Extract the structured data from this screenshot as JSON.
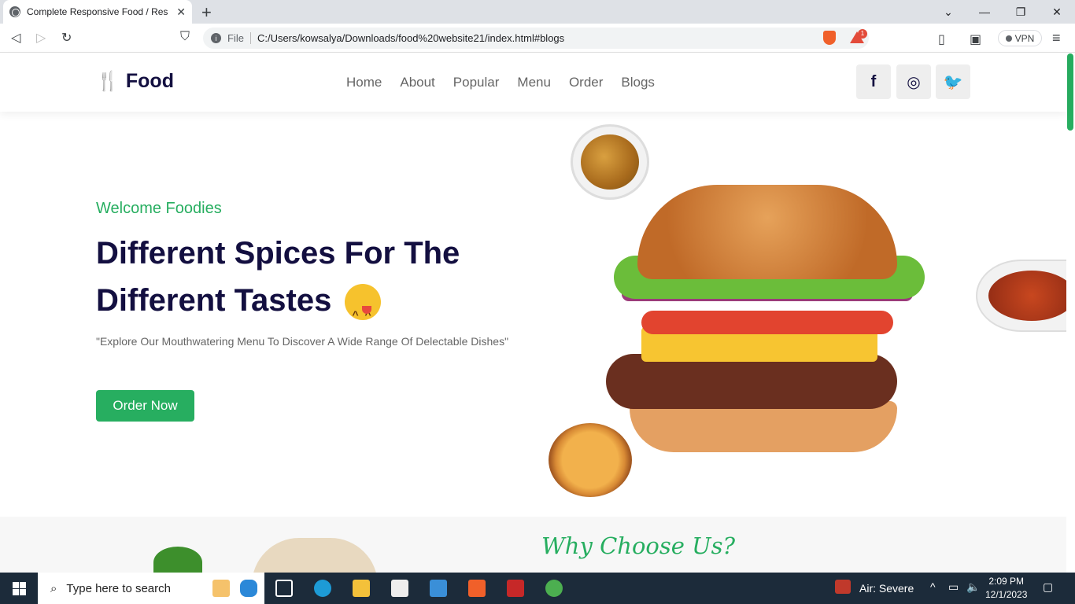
{
  "browser": {
    "tab_title": "Complete Responsive Food / Res",
    "new_tab": "+",
    "close_tab": "✕",
    "window_controls": {
      "minimize": "—",
      "maximize": "❐",
      "close": "✕",
      "chevron": "⌄"
    },
    "nav": {
      "back": "◁",
      "forward": "▷",
      "reload": "↻",
      "bookmark": "⛉"
    },
    "address_scheme_label": "File",
    "url": "C:/Users/kowsalya/Downloads/food%20website21/index.html#blogs",
    "rewards_badge": "1",
    "vpn_label": "VPN",
    "menu_icon": "≡"
  },
  "site": {
    "logo_icon": "🍴",
    "logo_text": "Food",
    "nav": [
      "Home",
      "About",
      "Popular",
      "Menu",
      "Order",
      "Blogs"
    ],
    "social": {
      "facebook": "f",
      "instagram": "◎",
      "twitter": "🐦"
    }
  },
  "hero": {
    "welcome": "Welcome Foodies",
    "title_line1": "Different Spices For The",
    "title_line2": "Different Tastes",
    "description": "\"Explore Our Mouthwatering Menu To Discover A Wide Range Of Delectable Dishes\"",
    "cta": "Order Now"
  },
  "why": {
    "title": "Why Choose Us?"
  },
  "taskbar": {
    "search_placeholder": "Type here to search",
    "weather": "Air: Severe",
    "time": "2:09 PM",
    "date": "12/1/2023"
  },
  "colors": {
    "brand_green": "#27ae60",
    "navy": "#130f40",
    "taskbar": "#1c2b3a"
  }
}
